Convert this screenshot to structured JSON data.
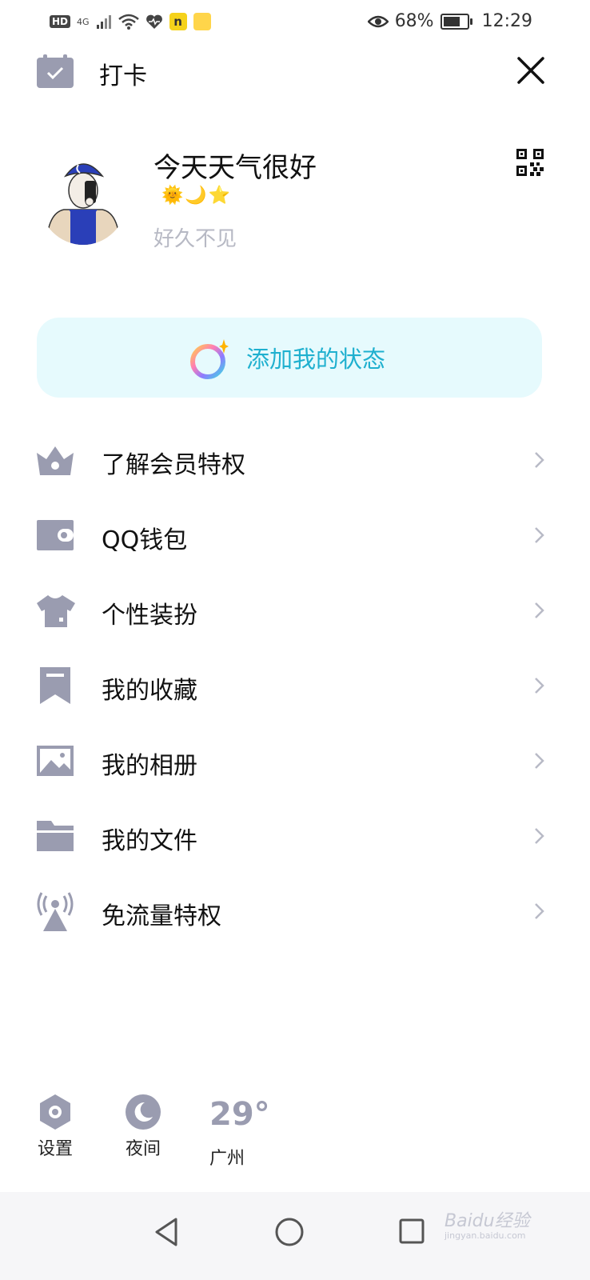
{
  "status_bar": {
    "hd": "HD",
    "network": "4G",
    "app_badge": "n",
    "battery": "68%",
    "time": "12:29"
  },
  "header": {
    "checkin_label": "打卡"
  },
  "profile": {
    "nickname": "今天天气很好",
    "emojis": "🌞🌙⭐",
    "signature": "好久不见"
  },
  "status_button": {
    "label": "添加我的状态"
  },
  "menu": {
    "items": [
      {
        "label": "了解会员特权",
        "icon": "crown-icon"
      },
      {
        "label": "QQ钱包",
        "icon": "wallet-icon"
      },
      {
        "label": "个性装扮",
        "icon": "tshirt-icon"
      },
      {
        "label": "我的收藏",
        "icon": "bookmark-icon"
      },
      {
        "label": "我的相册",
        "icon": "photo-icon"
      },
      {
        "label": "我的文件",
        "icon": "folder-icon"
      },
      {
        "label": "免流量特权",
        "icon": "signal-tower-icon"
      }
    ]
  },
  "footer": {
    "settings_label": "设置",
    "night_label": "夜间",
    "weather_temp": "29°",
    "weather_city": "广州"
  },
  "watermark": {
    "text": "Baidu经验",
    "sub": "jingyan.baidu.com"
  },
  "colors": {
    "icon_gray": "#9a9cb0",
    "accent_cyan": "#1fb0cf",
    "pill_bg": "#e6fafd"
  }
}
